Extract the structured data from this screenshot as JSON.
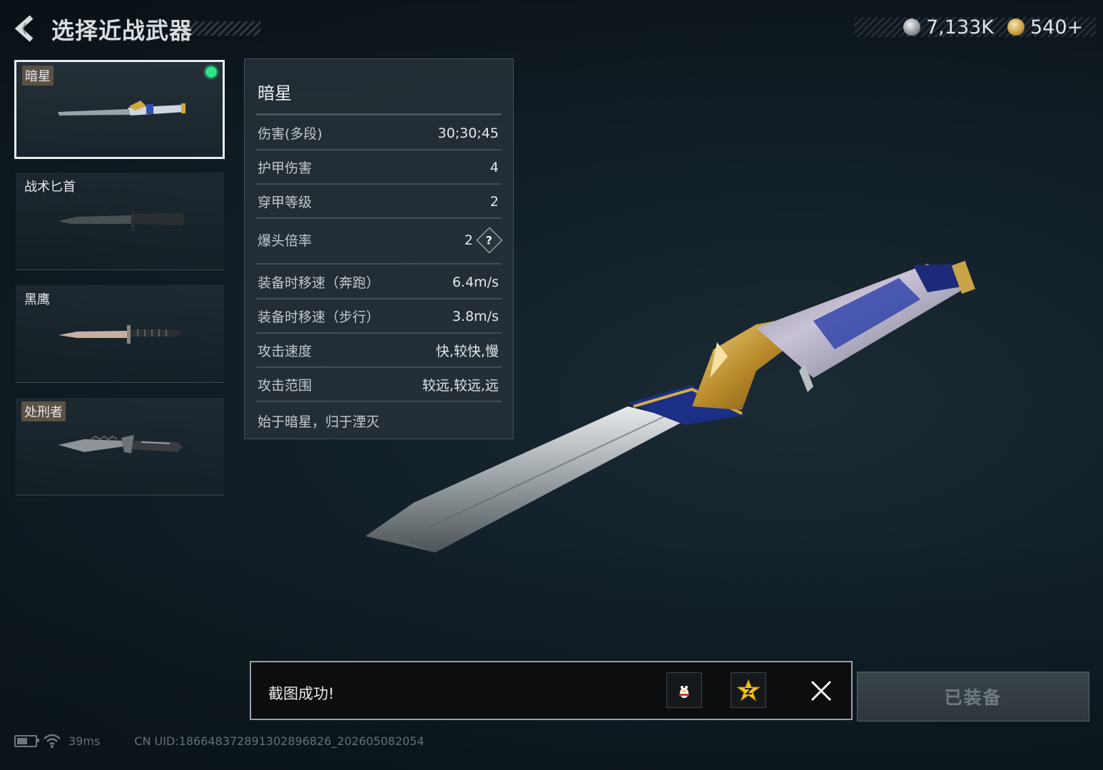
{
  "header": {
    "title": "选择近战武器",
    "currencies": [
      {
        "icon": "silver-coin-icon",
        "value": "7,133K"
      },
      {
        "icon": "gold-coin-icon",
        "value": "540+"
      }
    ]
  },
  "weapons": [
    {
      "name": "暗星",
      "selected": true,
      "equipped": true
    },
    {
      "name": "战术匕首",
      "selected": false,
      "equipped": false
    },
    {
      "name": "黑鹰",
      "selected": false,
      "equipped": false
    },
    {
      "name": "处刑者",
      "selected": false,
      "equipped": false
    }
  ],
  "stats": {
    "title": "暗星",
    "rows": [
      {
        "label": "伤害(多段)",
        "value": "30;30;45"
      },
      {
        "label": "护甲伤害",
        "value": "4"
      },
      {
        "label": "穿甲等级",
        "value": "2"
      },
      {
        "label": "爆头倍率",
        "value": "2"
      },
      {
        "label": "装备时移速（奔跑）",
        "value": "6.4m/s"
      },
      {
        "label": "装备时移速（步行）",
        "value": "3.8m/s"
      },
      {
        "label": "攻击速度",
        "value": "快,较快,慢"
      },
      {
        "label": "攻击范围",
        "value": "较远,较远,远"
      }
    ],
    "help_glyph": "?",
    "description": "始于暗星，归于湮灭"
  },
  "toast": {
    "message": "截图成功!"
  },
  "equip_button": {
    "label": "已装备"
  },
  "footer": {
    "latency": "39ms",
    "uid": "CN UID:18664837289130289682­6_202605082054"
  },
  "colors": {
    "equipped_indicator": "#2ee38a",
    "panel_bg": "#263038",
    "accent_gold": "#c99a3e"
  }
}
